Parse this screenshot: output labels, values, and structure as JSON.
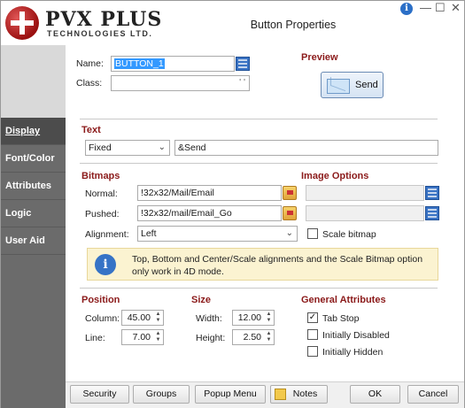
{
  "window": {
    "title": "Button Properties",
    "logo_main": "PVX PLUS",
    "logo_sub": "TECHNOLOGIES LTD.",
    "info_glyph": "i",
    "minimize_glyph": "—",
    "maximize_glyph": "☐",
    "close_glyph": "✕"
  },
  "sidebar": {
    "items": [
      {
        "label": "Display",
        "active": true
      },
      {
        "label": "Font/Color",
        "active": false
      },
      {
        "label": "Attributes",
        "active": false
      },
      {
        "label": "Logic",
        "active": false
      },
      {
        "label": "User Aid",
        "active": false
      }
    ]
  },
  "general": {
    "name_label": "Name:",
    "name_value": "BUTTON_1",
    "class_label": "Class:",
    "class_value": "",
    "class_suffix": "' '",
    "preview_heading": "Preview",
    "preview_button_label": "Send"
  },
  "text_section": {
    "heading": "Text",
    "type_value": "Fixed",
    "text_value": "&Send"
  },
  "bitmaps": {
    "heading": "Bitmaps",
    "normal_label": "Normal:",
    "normal_value": "!32x32/Mail/Email",
    "pushed_label": "Pushed:",
    "pushed_value": "!32x32/mail/Email_Go",
    "alignment_label": "Alignment:",
    "alignment_value": "Left"
  },
  "image_options": {
    "heading": "Image Options",
    "scale_bitmap_label": "Scale bitmap",
    "scale_bitmap_checked": false
  },
  "note": {
    "icon_glyph": "i",
    "text": "Top, Bottom and Center/Scale alignments and the Scale Bitmap option only work in 4D mode."
  },
  "position": {
    "heading": "Position",
    "column_label": "Column:",
    "column_value": "45.00",
    "line_label": "Line:",
    "line_value": "7.00"
  },
  "size": {
    "heading": "Size",
    "width_label": "Width:",
    "width_value": "12.00",
    "height_label": "Height:",
    "height_value": "2.50"
  },
  "general_attributes": {
    "heading": "General Attributes",
    "options": [
      {
        "label": "Tab Stop",
        "checked": true
      },
      {
        "label": "Initially Disabled",
        "checked": false
      },
      {
        "label": "Initially Hidden",
        "checked": false
      }
    ]
  },
  "buttons": {
    "security": "Security",
    "groups": "Groups",
    "popup_menu": "Popup Menu",
    "notes": "Notes",
    "ok": "OK",
    "cancel": "Cancel"
  },
  "colors": {
    "section_heading": "#8b1a1a",
    "sidebar_bg": "#6b6b6b",
    "sidebar_active": "#4c4c4c",
    "note_bg": "#fbf3d1",
    "selection": "#3399ff"
  }
}
